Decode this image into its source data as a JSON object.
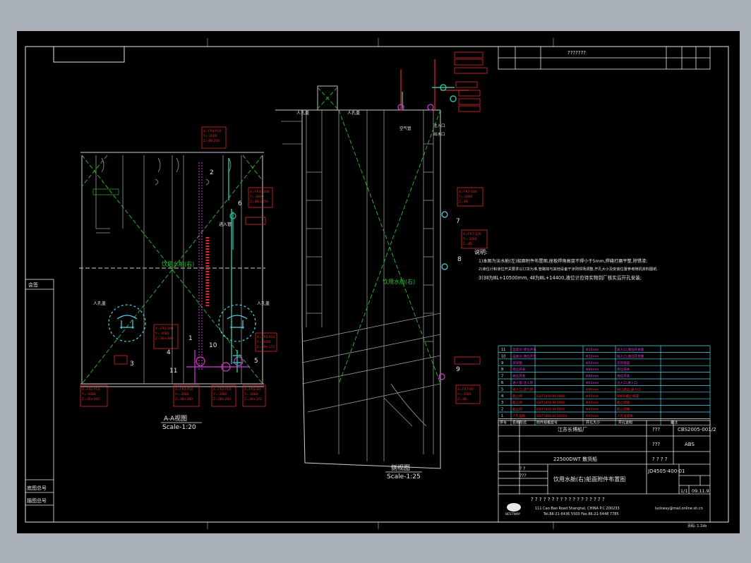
{
  "titles": {
    "view_a": "A-A视图",
    "view_a_scale": "Scale-1:20",
    "view_side": "侧视图",
    "view_side_scale": "Scale-1:25",
    "tank_label": "饮用水舱(右)",
    "tank_label_side": "饮用水舱(右)"
  },
  "notes": {
    "heading": "说明:",
    "line1": "1)本图为淡水舱(左)船面附件布置图,座板焊角高度不得小于5mm,焊缝打磨平整,除锈漆;",
    "line2": "2)液位计和液位开关要求以订货为准,管路如与其他设备干涉则现场调整,开孔大小及安装位置参考随机资料图纸.",
    "line3": "3)3Ⅱ为ⅢL+10500mm, 4Ⅱ为ⅢL+14400,液位计应待实物到厂核实后开孔安装;"
  },
  "callouts": {
    "c1": "1",
    "c2": "2",
    "c3": "3",
    "c4": "4",
    "c5": "5",
    "c6": "6",
    "c7": "7",
    "c8": "8",
    "c9": "9",
    "c10": "10",
    "c11": "11"
  },
  "labels": {
    "manhole": "人孔盖",
    "manhole_r": "人孔盖",
    "vent_in": "进入管",
    "air_pipe": "空气管",
    "inlet": "注入口",
    "outlet": "出水口",
    "level": "液位计"
  },
  "parts_table": {
    "rows": [
      {
        "no": "11",
        "name": "温度计-液位开关",
        "std": "",
        "size": "Φ15mm",
        "remark": "吸入口,液位开关座"
      },
      {
        "no": "10",
        "name": "温度计-液位开关",
        "std": "",
        "size": "Φ15mm",
        "remark": "吸入口,液位开关座"
      },
      {
        "no": "9",
        "name": "测深管",
        "std": "",
        "size": "Φ50mm",
        "remark": "测深管座"
      },
      {
        "no": "8",
        "name": "液位开关",
        "std": "",
        "size": "Φ80mm",
        "remark": "液位开关"
      },
      {
        "no": "7",
        "name": "液位开关",
        "std": "",
        "size": "Φ80mm",
        "remark": "液位开关"
      },
      {
        "no": "6",
        "name": "进入管-注入管",
        "std": "",
        "size": "Φ65mm",
        "remark": "注入口,进入口"
      },
      {
        "no": "5",
        "name": "吸入口-透气管",
        "std": "",
        "size": "Φ80mm",
        "remark": "吸口进出,吸入口"
      },
      {
        "no": "4",
        "name": "截止阀",
        "std": "GB/T1858-94 DN80",
        "size": "Φ45mm",
        "remark": "DN80截止阀座"
      },
      {
        "no": "3",
        "name": "截止阀",
        "std": "GB/T1858-94 DN80",
        "size": "Φ45mm",
        "remark": "截止阀座"
      },
      {
        "no": "2",
        "name": "截止阀",
        "std": "GB/T1858-94 DN50",
        "size": "Φ45mm",
        "remark": "截止阀座"
      },
      {
        "no": "1",
        "name": "人孔盖板",
        "std": "GB/T1868-94 DN500",
        "size": "Φ45mm",
        "remark": "人孔盖座板"
      }
    ],
    "header": {
      "no": "序号",
      "name": "名称形式",
      "std": "附件规格型号",
      "size": "开孔大小",
      "remark": "开孔说明",
      "note": "备注"
    }
  },
  "title_block": {
    "company": "江苏长博船厂",
    "drawing_no": "CBS2005-001/2",
    "ship_type": "22500DWT 散货船",
    "class": "ABS",
    "drawing_title": "饮用水舱(右)船面附件布置图",
    "code": "JD4505-400-01",
    "sheet": "1/1",
    "date": "09.11.9",
    "q1": "???",
    "q2": "???",
    "q3": "? ? ? ?",
    "q4": "? ?",
    "q5": "???",
    "top_marks": "???????",
    "footer_q": "? ? ? ? ? ? ? ? ? ? ? ? ? ? ? ? ? ?",
    "logo_text": "BESTWAY",
    "address": "111 Cao Bao Road Shanghai, CHINA    P.C.200233",
    "tel": "Tel.86-21-6436 5500  Fax.86-21-5448 7785",
    "email": "luckway@mail.online.sh.cn"
  },
  "left_panel": {
    "sign1": "会签",
    "sign2": "底图总号",
    "sign3": "描图总号"
  },
  "page_mark": "页码: 1.1kb"
}
